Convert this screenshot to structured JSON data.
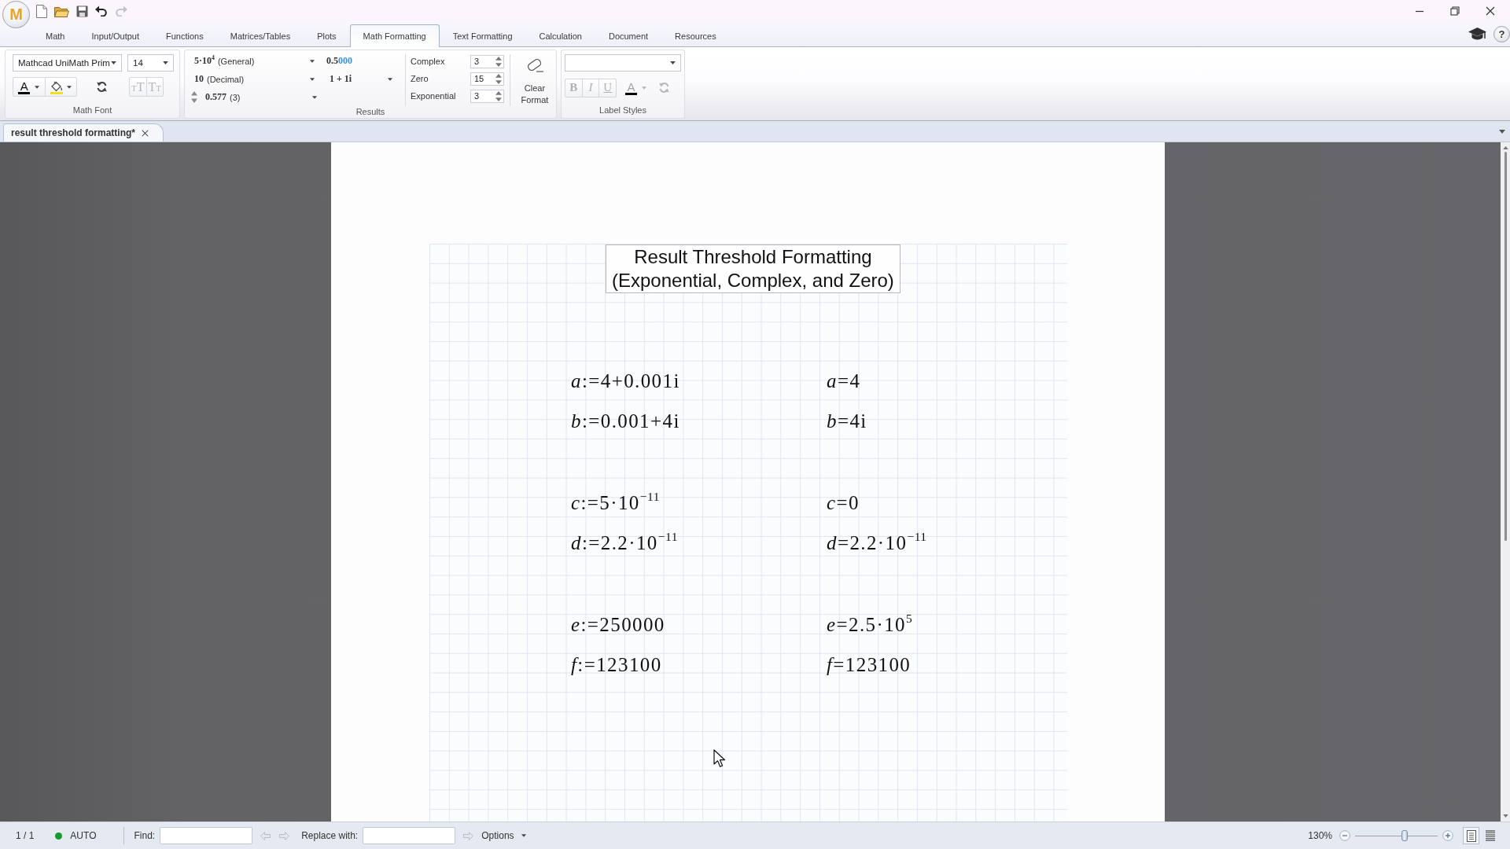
{
  "app_logo": {
    "letter": "M"
  },
  "ribbon_tabs": [
    {
      "label": "Math",
      "selected": false
    },
    {
      "label": "Input/Output",
      "selected": false
    },
    {
      "label": "Functions",
      "selected": false
    },
    {
      "label": "Matrices/Tables",
      "selected": false
    },
    {
      "label": "Plots",
      "selected": false
    },
    {
      "label": "Math Formatting",
      "selected": true
    },
    {
      "label": "Text Formatting",
      "selected": false
    },
    {
      "label": "Calculation",
      "selected": false
    },
    {
      "label": "Document",
      "selected": false
    },
    {
      "label": "Resources",
      "selected": false
    }
  ],
  "help_button": {
    "glyph": "?"
  },
  "ribbon": {
    "math_font": {
      "font": "Mathcad UniMath Prim",
      "size": "14",
      "color_button": {
        "glyph": "A"
      },
      "size_buttons": [
        {
          "kind": "grow",
          "glyphs": [
            "T",
            "T"
          ],
          "disabled": true
        },
        {
          "kind": "shrink",
          "glyphs": [
            "T",
            "T"
          ],
          "disabled": true
        }
      ],
      "group_label": "Math Font"
    },
    "results": {
      "format": {
        "sample": "5·10$^{4}$",
        "label": "(General)"
      },
      "radix": {
        "sample": "10",
        "label": "(Decimal)"
      },
      "precision": {
        "sample": "0.577",
        "label": "(3)"
      },
      "trailing_zeros": {
        "digits": "0.5",
        "zeros": "000"
      },
      "complex": "1 + 1i",
      "thresholds": [
        {
          "label": "Complex",
          "value": "3"
        },
        {
          "label": "Zero",
          "value": "15"
        },
        {
          "label": "Exponential",
          "value": "3"
        }
      ],
      "clear_format": "Clear Format",
      "group_label": "Results"
    },
    "label_styles": {
      "style_buttons": [
        {
          "kind": "bold",
          "glyph": "B",
          "disabled": true
        },
        {
          "kind": "italic",
          "glyph": "I",
          "disabled": true
        },
        {
          "kind": "underline",
          "glyph": "U",
          "disabled": true
        }
      ],
      "color_button": {
        "glyph": "A",
        "disabled": true
      },
      "group_label": "Label Styles"
    }
  },
  "document_tabs": [
    {
      "label": "result threshold formatting*",
      "selected": true
    }
  ],
  "worksheet": {
    "title_lines": [
      "Result Threshold Formatting",
      "(Exponential, Complex, and Zero)"
    ],
    "groups": [
      {
        "rows": [
          {
            "definition": "*a*:=4+0.001i",
            "result": "*a*=4"
          },
          {
            "definition": "*b*:=0.001+4i",
            "result": "*b*=4i"
          }
        ]
      },
      {
        "rows": [
          {
            "definition": "*c*:=5·10$^{−11}$",
            "result": "*c*=0"
          },
          {
            "definition": "*d*:=2.2·10$^{−11}$",
            "result": "*d*=2.2·10$^{−11}$"
          }
        ]
      },
      {
        "rows": [
          {
            "definition": "*e*:=250000",
            "result": "*e*=2.5·10$^{5}$"
          },
          {
            "definition": "*f*:=123100",
            "result": "*f*=123100"
          }
        ]
      }
    ]
  },
  "status_bar": {
    "page": "1 / 1",
    "calc_mode": "AUTO",
    "find_label": "Find:",
    "replace_label": "Replace with:",
    "options": "Options",
    "zoom": {
      "reading": "130%",
      "level": 0.6
    }
  }
}
